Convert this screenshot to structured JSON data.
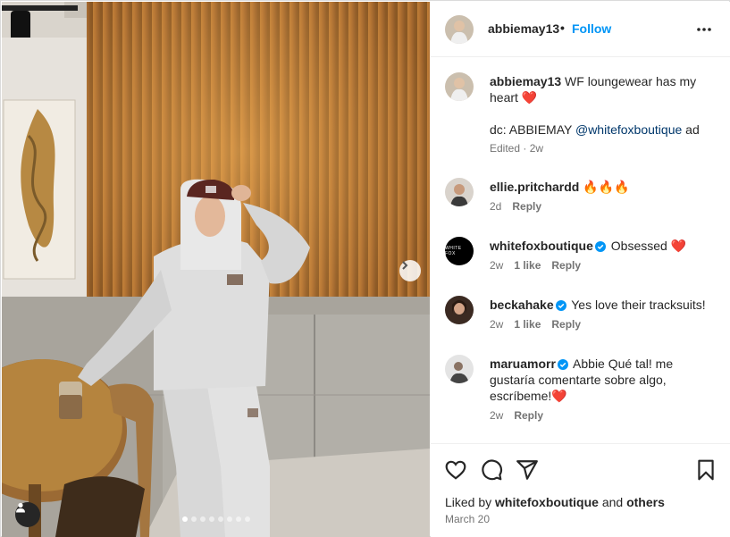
{
  "post": {
    "author": "abbiemay13",
    "separator": "•",
    "follow_label": "Follow",
    "more_icon": "more-horizontal-icon",
    "carousel_dots": 8,
    "active_dot": 0
  },
  "caption": {
    "user": "abbiemay13",
    "text": " WF loungewear has my heart ❤️",
    "line2_prefix": "dc: ABBIEMAY ",
    "line2_mention": "@whitefoxboutique",
    "line2_suffix": " ad",
    "meta": "Edited · 2w"
  },
  "comments": [
    {
      "user": "ellie.pritchardd",
      "verified": false,
      "text": " 🔥🔥🔥",
      "time": "2d",
      "likes": "",
      "reply": "Reply"
    },
    {
      "user": "whitefoxboutique",
      "verified": true,
      "text": " Obsessed ❤️",
      "time": "2w",
      "likes": "1 like",
      "reply": "Reply",
      "avatar_text": "WHITE FOX"
    },
    {
      "user": "beckahake",
      "verified": true,
      "text": " Yes love their tracksuits!",
      "time": "2w",
      "likes": "1 like",
      "reply": "Reply"
    },
    {
      "user": "maruamorr",
      "verified": true,
      "text": " Abbie Qué tal! me gustaría comentarte sobre algo, escríbeme!❤️",
      "time": "2w",
      "likes": "",
      "reply": "Reply"
    }
  ],
  "footer": {
    "liked_prefix": "Liked by ",
    "liked_user": "whitefoxboutique",
    "liked_and": " and ",
    "liked_others": "others",
    "date": "March 20"
  },
  "colors": {
    "accent": "#0095f6",
    "verified": "#0095f6",
    "text": "#262626",
    "muted": "#737373"
  }
}
